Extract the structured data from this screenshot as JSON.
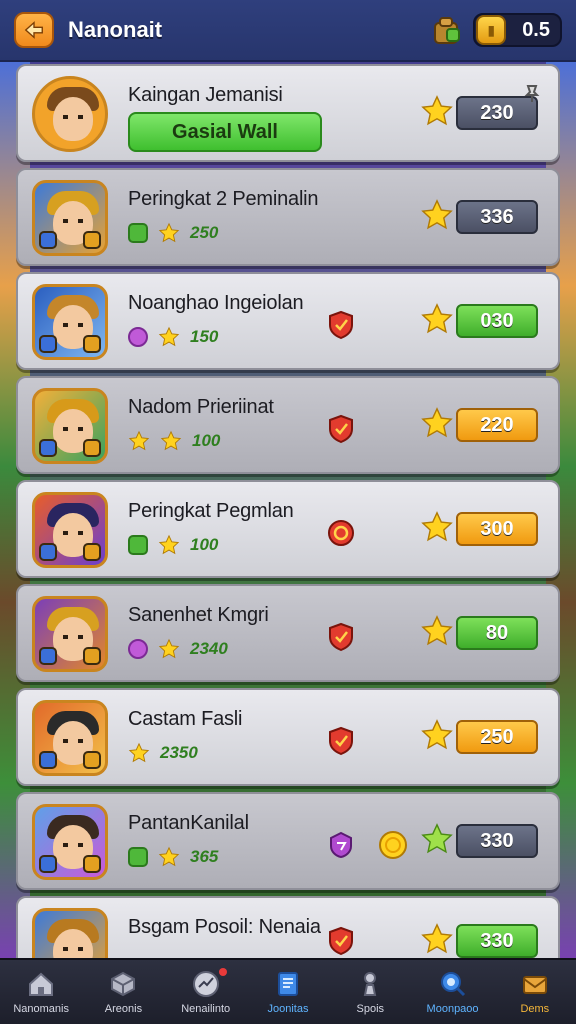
{
  "header": {
    "title": "Nanonait",
    "coin_value": "0.5"
  },
  "rows": [
    {
      "name": "Kaingan Jemanisi",
      "button": "Gasial Wall",
      "score": "230",
      "score_style": "grey",
      "avatar": "round"
    },
    {
      "name": "Peringkat 2 Peminalin",
      "sub_value": "250",
      "sub_icon": "green",
      "score": "336",
      "score_style": "grey"
    },
    {
      "name": "Noanghao Ingeiolan",
      "sub_value": "150",
      "sub_icon": "purple",
      "score": "030",
      "score_style": "green",
      "mid_icon": "red-shield"
    },
    {
      "name": "Nadom Prieriinat",
      "sub_value": "100",
      "sub_icon": "star",
      "score": "220",
      "score_style": "orange",
      "mid_icon": "red-shield"
    },
    {
      "name": "Peringkat Pegmlan",
      "sub_value": "100",
      "sub_icon": "green",
      "score": "300",
      "score_style": "orange",
      "mid_icon": "red-target"
    },
    {
      "name": "Sanenhet Kmgri",
      "sub_value": "2340",
      "sub_icon": "purple",
      "score": "80",
      "score_style": "green",
      "mid_icon": "red-shield"
    },
    {
      "name": "Castam Fasli",
      "sub_value": "2350",
      "sub_icon": "star",
      "score": "250",
      "score_style": "orange",
      "mid_icon": "red-shield"
    },
    {
      "name": "PantanKanilal",
      "sub_value": "365",
      "sub_icon": "green",
      "score": "330",
      "score_style": "grey",
      "mid_icon": "purple-badge"
    },
    {
      "name": "Bsgam Posoil: Nenaia",
      "score": "330",
      "score_style": "green",
      "mid_icon": "red-shield"
    }
  ],
  "nav": [
    {
      "label": "Nanomanis",
      "icon": "home-icon"
    },
    {
      "label": "Areonis",
      "icon": "cube-icon"
    },
    {
      "label": "Nenailinto",
      "icon": "chart-icon"
    },
    {
      "label": "Joonitas",
      "icon": "book-icon"
    },
    {
      "label": "Spois",
      "icon": "pawn-icon"
    },
    {
      "label": "Moonpaoo",
      "icon": "search-icon"
    },
    {
      "label": "Dems",
      "icon": "mail-icon"
    }
  ],
  "colors": {
    "topbar": "#2f3f7d",
    "accent_green": "#3fbf2f",
    "accent_orange": "#f09a10",
    "nav_active": "#5fb4ff"
  }
}
